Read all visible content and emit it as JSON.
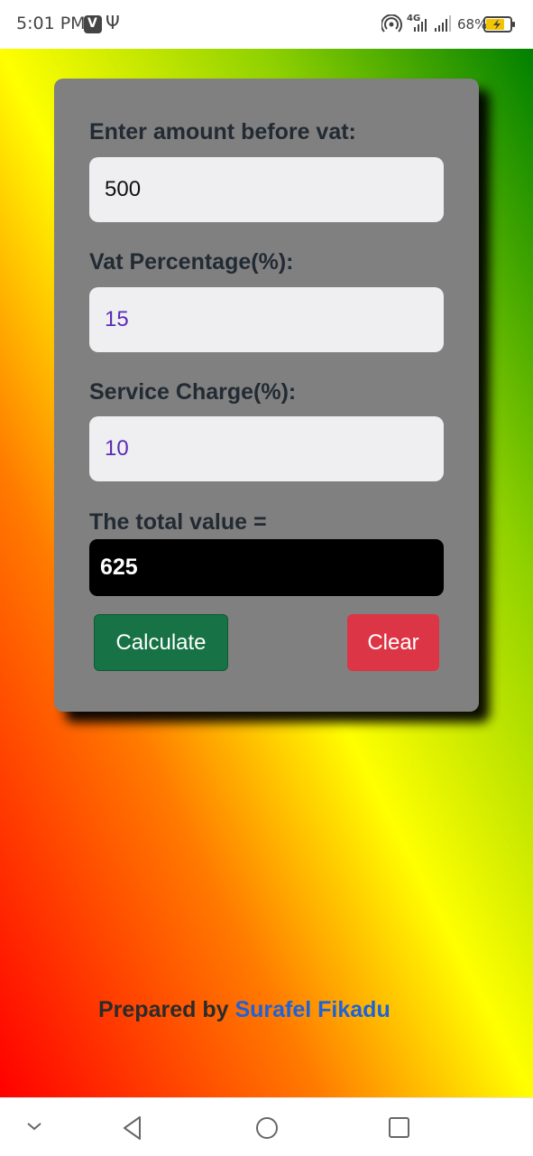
{
  "status_bar": {
    "time": "5:01 PM",
    "network": "4G",
    "battery_percent": "68%",
    "icons": [
      "v-app-icon",
      "usb-icon",
      "hotspot-icon",
      "signal-4g-icon",
      "signal-icon",
      "battery-charging-icon"
    ]
  },
  "form": {
    "amount_label": "Enter amount before vat:",
    "amount_value": "500",
    "vat_label": "Vat Percentage(%):",
    "vat_value": "15",
    "service_label": "Service Charge(%):",
    "service_value": "10",
    "total_label": "The total value =",
    "total_value": "625"
  },
  "buttons": {
    "calculate": "Calculate",
    "clear": "Clear"
  },
  "footer": {
    "prepared_by": "Prepared by ",
    "author": "Surafel Fikadu"
  },
  "nav_bar": {
    "icons": [
      "chevron-down-icon",
      "back-icon",
      "home-icon",
      "recents-icon"
    ]
  },
  "colors": {
    "card_bg": "#808080",
    "calculate_btn": "#177245",
    "clear_btn": "#dc3545",
    "author_link": "#1e63d6",
    "result_bg": "#000000"
  }
}
